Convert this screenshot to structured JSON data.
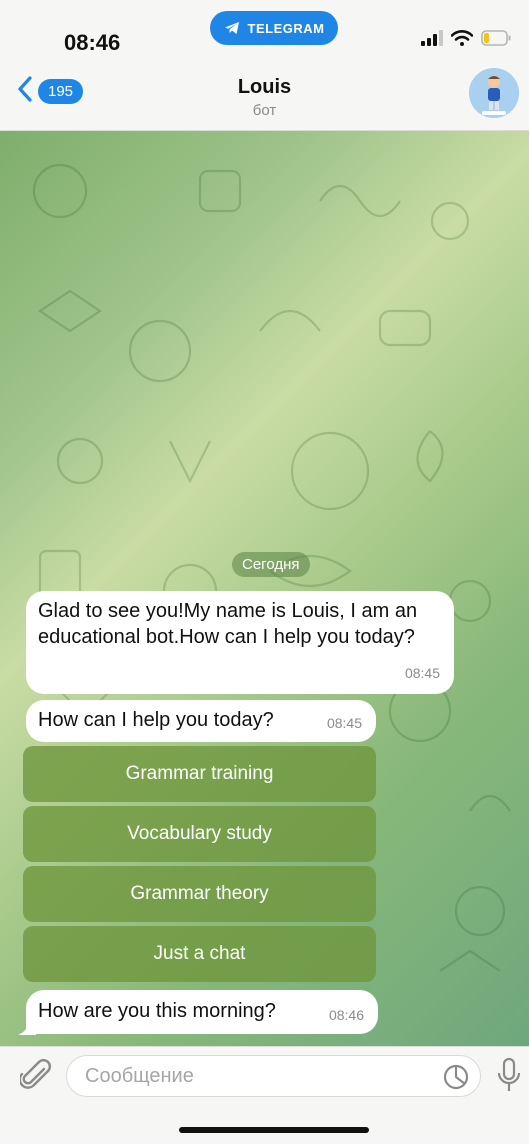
{
  "status_bar": {
    "time": "08:46",
    "app_badge": "TELEGRAM"
  },
  "header": {
    "back_count": "195",
    "title": "Louis",
    "subtitle": "бот"
  },
  "chat": {
    "date_separator": "Сегодня",
    "messages": [
      {
        "text": "Glad to see you!My name is Louis, I am an educational bot.How can I help you today?",
        "time": "08:45"
      },
      {
        "text": "How can I help you today?",
        "time": "08:45"
      },
      {
        "text": "How are you this morning?",
        "time": "08:46"
      }
    ],
    "keyboard_buttons": [
      {
        "label": "Grammar training"
      },
      {
        "label": "Vocabulary study"
      },
      {
        "label": "Grammar theory"
      },
      {
        "label": "Just a chat"
      }
    ]
  },
  "input": {
    "placeholder": "Сообщение",
    "value": ""
  },
  "colors": {
    "accent": "#1f86e6",
    "keyboard_button": "#6e963c",
    "chat_background": "#9fc48a"
  }
}
